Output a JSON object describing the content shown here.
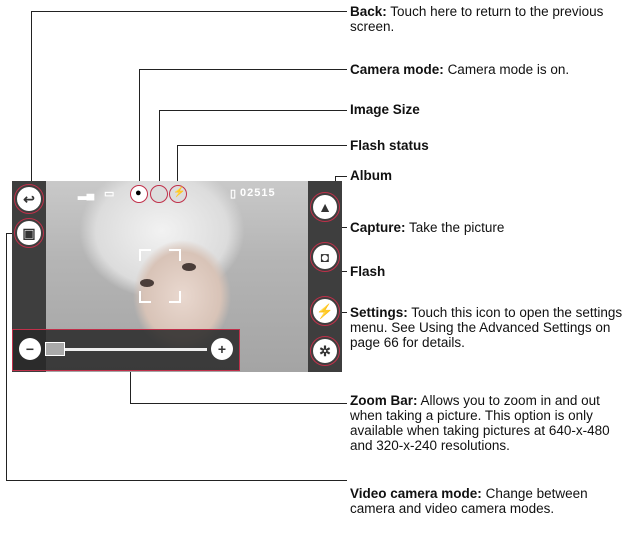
{
  "callouts": {
    "back": {
      "title": "Back:",
      "text": "Touch here to return to the previous screen."
    },
    "camera_mode": {
      "title": "Camera mode:",
      "text": "Camera mode is on."
    },
    "image_size": {
      "title": "Image Size",
      "text": ""
    },
    "flash_status": {
      "title": "Flash status",
      "text": ""
    },
    "album": {
      "title": "Album",
      "text": ""
    },
    "capture": {
      "title": "Capture:",
      "text": "Take the picture"
    },
    "flash": {
      "title": "Flash",
      "text": ""
    },
    "settings": {
      "title": "Settings:",
      "text": "Touch this icon to open the settings menu. See Using the Advanced Settings on page 66 for details."
    },
    "zoom_bar": {
      "title": "Zoom Bar:",
      "text": "Allows you to zoom in and out when taking a picture. This option is only available when taking pictures at 640-x-480 and 320-x-240 resolutions."
    },
    "video_mode": {
      "title": "Video camera mode:",
      "text": "Change between camera and video camera modes."
    }
  },
  "screen": {
    "counter": "02515",
    "icons": {
      "back": "back-arrow-icon",
      "video": "video-camera-icon",
      "album": "album-icon",
      "capture": "capture-camera-icon",
      "flash": "flash-icon",
      "settings": "gear-icon",
      "zoom_out": "minus-icon",
      "zoom_in": "plus-icon"
    }
  }
}
